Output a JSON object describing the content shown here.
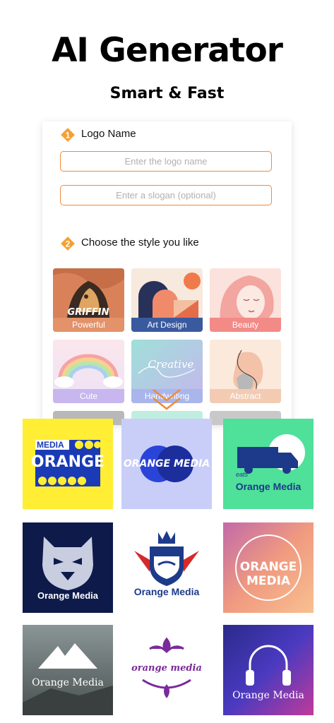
{
  "header": {
    "title": "AI Generator",
    "subtitle": "Smart & Fast"
  },
  "form": {
    "step1": {
      "number": "1",
      "label": "Logo Name"
    },
    "logo_name_placeholder": "Enter the logo name",
    "slogan_placeholder": "Enter a slogan (optional)",
    "step2": {
      "number": "2",
      "label": "Choose the style you like"
    }
  },
  "styles": [
    {
      "label": "Powerful",
      "tile_text": "GRIFFIN"
    },
    {
      "label": "Art Design"
    },
    {
      "label": "Beauty"
    },
    {
      "label": "Cute"
    },
    {
      "label": "Handwriting",
      "tile_text": "Creative"
    },
    {
      "label": "Abstract"
    }
  ],
  "logos": [
    {
      "line1": "MEDIA",
      "line2": "ORANGE"
    },
    {
      "text": "ORANGE MEDIA"
    },
    {
      "small": "eats",
      "text": "Orange Media"
    },
    {
      "text": "Orange Media"
    },
    {
      "text": "Orange Media"
    },
    {
      "text": "ORANGE MEDIA"
    },
    {
      "text": "Orange Media"
    },
    {
      "text": "orange media"
    },
    {
      "text": "Orange Media"
    }
  ],
  "colors": {
    "accent": "#f08a3a",
    "step_badge": "#f5a033"
  },
  "icons": {
    "expand": "chevron-down-icon"
  }
}
